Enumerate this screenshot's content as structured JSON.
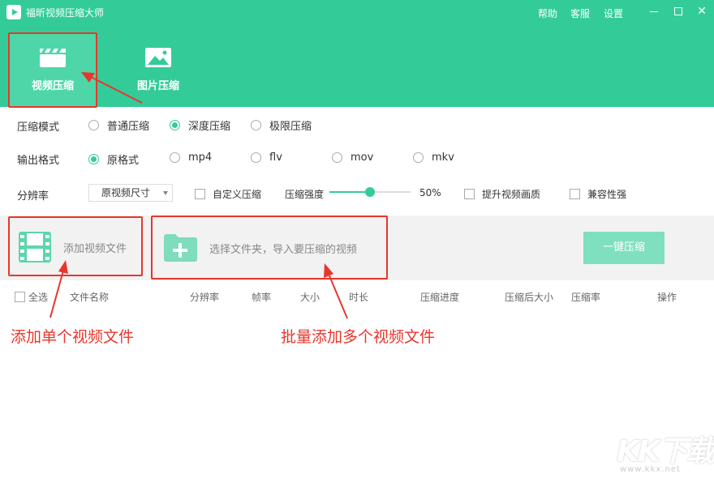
{
  "app": {
    "title": "福昕视频压缩大师"
  },
  "top_links": {
    "help": "帮助",
    "service": "客服",
    "settings": "设置"
  },
  "tabs": [
    {
      "label": "视频压缩",
      "icon": "clapperboard-icon",
      "active": true
    },
    {
      "label": "图片压缩",
      "icon": "image-icon",
      "active": false
    }
  ],
  "compress_mode": {
    "label": "压缩模式",
    "options": [
      "普通压缩",
      "深度压缩",
      "极限压缩"
    ],
    "selected": "深度压缩"
  },
  "output_format": {
    "label": "输出格式",
    "options": [
      "原格式",
      "mp4",
      "flv",
      "mov",
      "mkv"
    ],
    "selected": "原格式"
  },
  "resolution": {
    "label": "分辨率",
    "selected": "原视频尺寸",
    "custom_label": "自定义压缩",
    "strength_label": "压缩强度",
    "strength_value": 50,
    "strength_text": "50%",
    "enhance_label": "提升视频画质",
    "compat_label": "兼容性强"
  },
  "actions": {
    "add_file": "添加视频文件",
    "add_folder": "选择文件夹，导入要压缩的视频",
    "compress_all": "一键压缩"
  },
  "table": {
    "select_all": "全选",
    "columns": [
      "文件名称",
      "分辨率",
      "帧率",
      "大小",
      "时长",
      "压缩进度",
      "压缩后大小",
      "压缩率",
      "操作"
    ]
  },
  "annotations": {
    "single": "添加单个视频文件",
    "batch": "批量添加多个视频文件"
  },
  "watermark": {
    "logo": "KK下载",
    "url": "www.kkx.net"
  },
  "colors": {
    "brand": "#33cc99",
    "annotation": "#e8362c",
    "button": "#7fe0bf"
  }
}
